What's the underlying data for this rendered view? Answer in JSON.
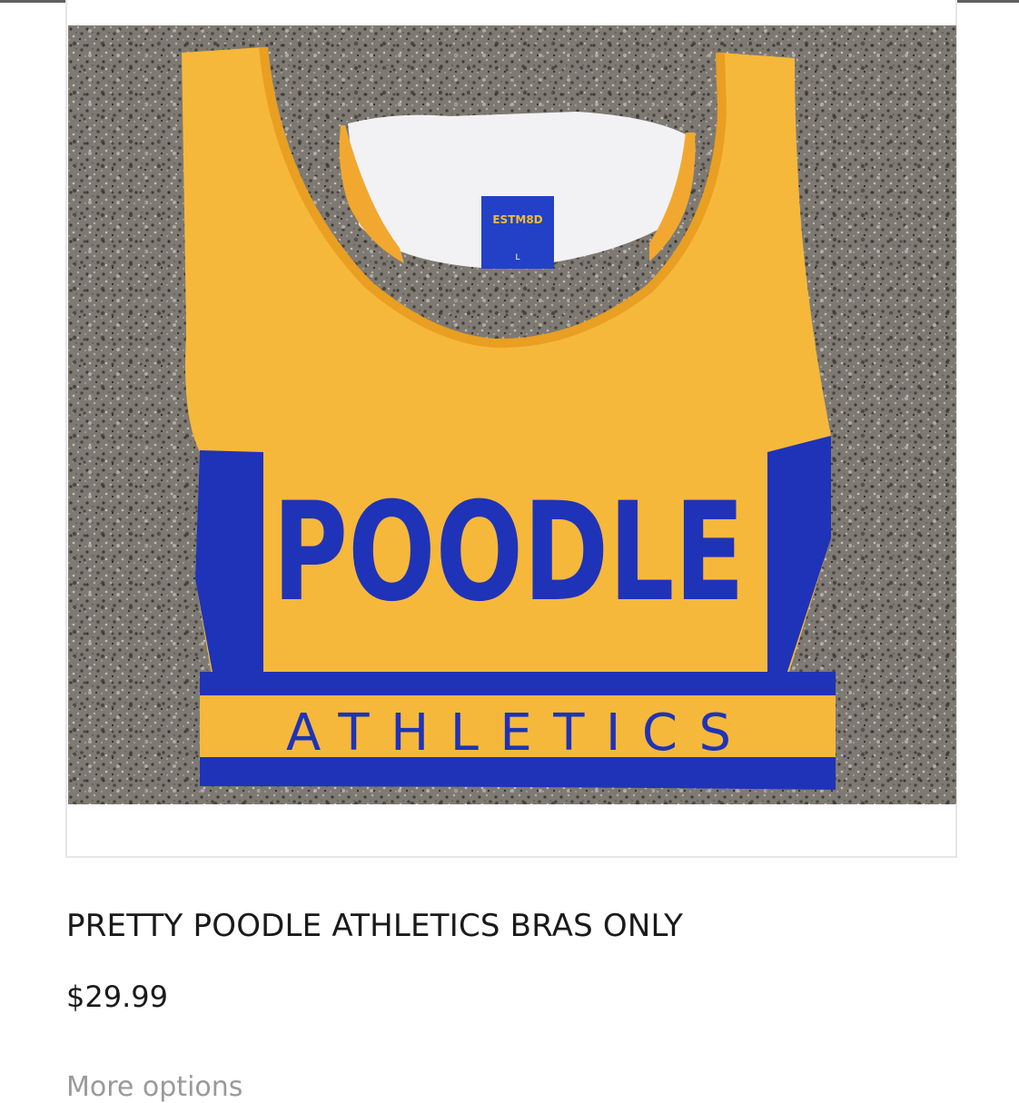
{
  "product": {
    "title": "PRETTY POODLE ATHLETICS BRAS ONLY",
    "price": "$29.99",
    "more_options": "More options",
    "image": {
      "label_tag": "ESTM8D",
      "label_size": "L",
      "chest_text": "POODLE",
      "band_text": "ATHLETICS"
    }
  },
  "colors": {
    "garment_gold": "#f6b83a",
    "garment_blue": "#1f33b8",
    "pavement": "#7d7a74"
  }
}
